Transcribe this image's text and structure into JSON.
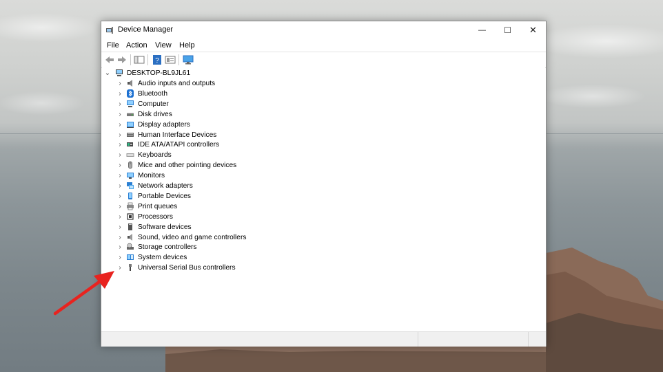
{
  "window": {
    "title": "Device Manager",
    "controls": {
      "minimize": "—",
      "maximize": "☐",
      "close": "✕"
    }
  },
  "menu": [
    "File",
    "Action",
    "View",
    "Help"
  ],
  "toolbar": {
    "buttons": [
      "back-icon",
      "forward-icon",
      "show-hide-console-tree-icon",
      "help-icon",
      "properties-icon",
      "monitor-icon"
    ]
  },
  "tree": {
    "root": "DESKTOP-BL9JL61",
    "items": [
      {
        "label": "Audio inputs and outputs",
        "icon": "speaker-icon"
      },
      {
        "label": "Bluetooth",
        "icon": "bluetooth-icon"
      },
      {
        "label": "Computer",
        "icon": "computer-icon"
      },
      {
        "label": "Disk drives",
        "icon": "disk-drive-icon"
      },
      {
        "label": "Display adapters",
        "icon": "display-adapter-icon"
      },
      {
        "label": "Human Interface Devices",
        "icon": "hid-icon"
      },
      {
        "label": "IDE ATA/ATAPI controllers",
        "icon": "ide-controller-icon"
      },
      {
        "label": "Keyboards",
        "icon": "keyboard-icon"
      },
      {
        "label": "Mice and other pointing devices",
        "icon": "mouse-icon"
      },
      {
        "label": "Monitors",
        "icon": "monitor-icon"
      },
      {
        "label": "Network adapters",
        "icon": "network-adapter-icon"
      },
      {
        "label": "Portable Devices",
        "icon": "portable-device-icon"
      },
      {
        "label": "Print queues",
        "icon": "printer-icon"
      },
      {
        "label": "Processors",
        "icon": "processor-icon"
      },
      {
        "label": "Software devices",
        "icon": "software-device-icon"
      },
      {
        "label": "Sound, video and game controllers",
        "icon": "sound-controller-icon"
      },
      {
        "label": "Storage controllers",
        "icon": "storage-controller-icon"
      },
      {
        "label": "System devices",
        "icon": "system-device-icon"
      },
      {
        "label": "Universal Serial Bus controllers",
        "icon": "usb-icon"
      }
    ]
  },
  "colors": {
    "accent_arrow": "#e8231f",
    "icon_blue": "#2b7fd3"
  }
}
